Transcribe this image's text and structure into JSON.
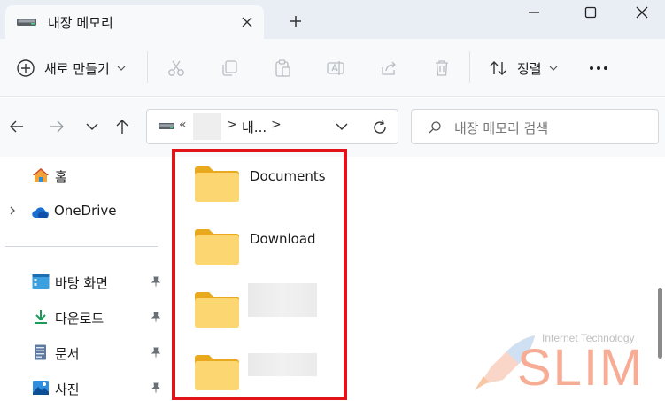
{
  "window": {
    "tab_title": "내장 메모리",
    "new_tab_symbol": "+"
  },
  "toolbar": {
    "new_label": "새로 만들기",
    "sort_label": "정렬",
    "more_symbol": "⋯"
  },
  "address": {
    "overflow_symbol": "«",
    "separator": ">",
    "crumb": "내...",
    "search_placeholder": "내장 메모리 검색"
  },
  "sidebar": {
    "home": "홈",
    "onedrive": "OneDrive",
    "quick": [
      {
        "label": "바탕 화면"
      },
      {
        "label": "다운로드"
      },
      {
        "label": "문서"
      },
      {
        "label": "사진"
      }
    ]
  },
  "folders": [
    {
      "name": "Documents"
    },
    {
      "name": "Download"
    }
  ],
  "watermark": {
    "line1": "Internet Technology",
    "line2": "SLIM"
  },
  "colors": {
    "highlight": "#e1141a",
    "folder": "#f5c443",
    "accent": "#0067c0"
  }
}
